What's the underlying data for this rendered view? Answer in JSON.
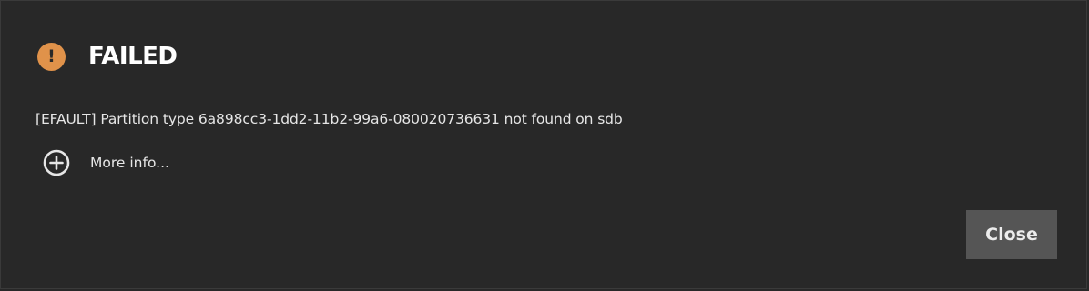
{
  "dialog": {
    "status_icon": "warning-circle-icon",
    "status_icon_glyph": "!",
    "title": "FAILED",
    "message": "[EFAULT] Partition type 6a898cc3-1dd2-11b2-99a6-080020736631 not found on sdb",
    "more_info": {
      "icon": "plus-circle-icon",
      "label": "More info..."
    },
    "close_label": "Close"
  },
  "colors": {
    "background": "#282828",
    "warning": "#e0924a",
    "text": "#e6e6e6",
    "title": "#ffffff",
    "button": "#555555"
  }
}
